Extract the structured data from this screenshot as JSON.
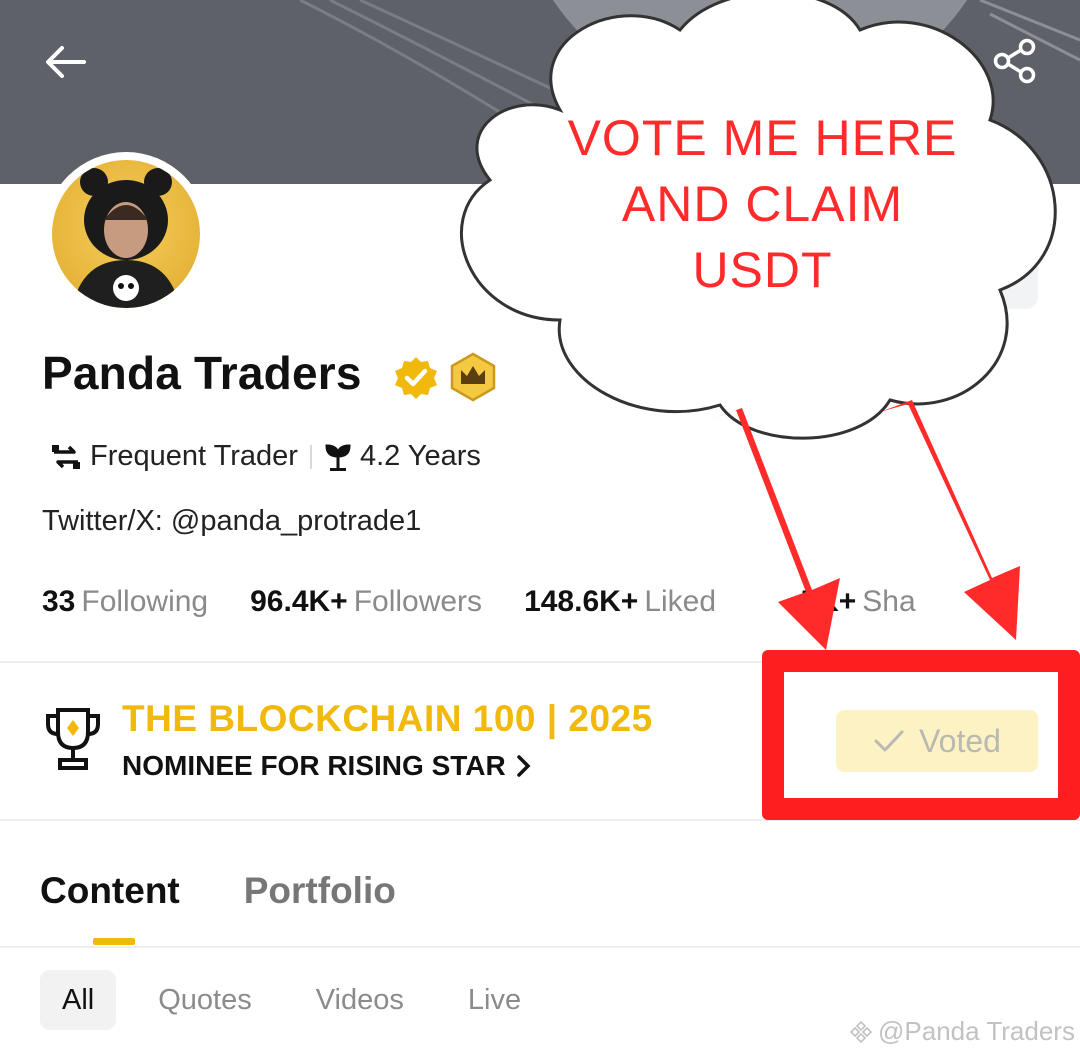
{
  "header": {
    "back_icon": "arrow-left-icon",
    "share_icon": "share-icon"
  },
  "profile": {
    "name": "Panda Traders",
    "tags": [
      {
        "icon": "swap-arrows-icon",
        "label": "Frequent Trader"
      },
      {
        "icon": "plant-icon",
        "label": "4.2 Years"
      }
    ],
    "bio": "Twitter/X: @panda_protrade1",
    "stats": [
      {
        "value": "33",
        "label": "Following"
      },
      {
        "value": "96.4K+",
        "label": "Followers"
      },
      {
        "value": "148.6K+",
        "label": "Liked"
      },
      {
        "value": ".5K+",
        "label": "Sha"
      }
    ]
  },
  "award": {
    "title": "THE BLOCKCHAIN 100 | 2025",
    "subtitle": "NOMINEE FOR RISING STAR",
    "vote_label": "Voted"
  },
  "tabs": [
    {
      "label": "Content",
      "active": true
    },
    {
      "label": "Portfolio",
      "active": false
    }
  ],
  "filters": [
    {
      "label": "All",
      "active": true
    },
    {
      "label": "Quotes",
      "active": false
    },
    {
      "label": "Videos",
      "active": false
    },
    {
      "label": "Live",
      "active": false
    }
  ],
  "annotation": {
    "lines": [
      "VOTE ME HERE",
      "AND CLAIM",
      "USDT"
    ],
    "color": "#ff2a2a"
  },
  "watermark": "@Panda Traders",
  "colors": {
    "brand_yellow": "#f0b90b",
    "header_gray": "#5e6168",
    "annotation_red": "#ff1f1f"
  }
}
